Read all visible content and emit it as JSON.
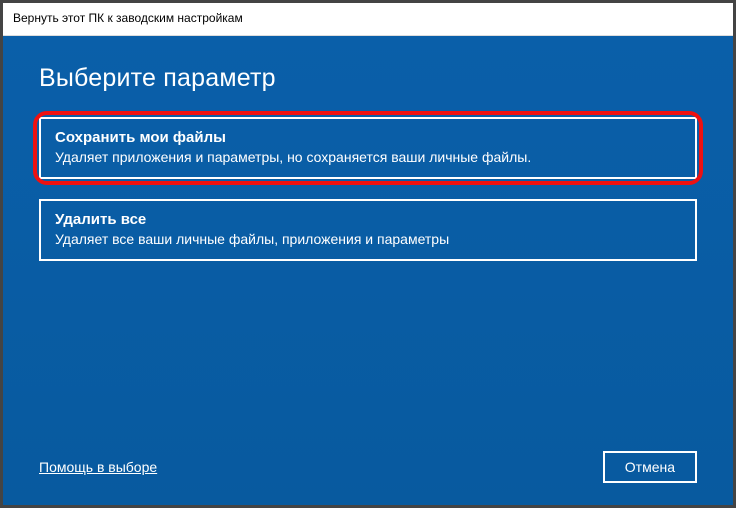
{
  "window": {
    "title": "Вернуть этот ПК к заводским настройкам"
  },
  "heading": "Выберите параметр",
  "options": [
    {
      "title": "Сохранить мои файлы",
      "description": "Удаляет приложения и параметры, но сохраняется ваши личные файлы."
    },
    {
      "title": "Удалить все",
      "description": "Удаляет все ваши личные файлы, приложения и параметры"
    }
  ],
  "footer": {
    "help": "Помощь в выборе",
    "cancel": "Отмена"
  }
}
